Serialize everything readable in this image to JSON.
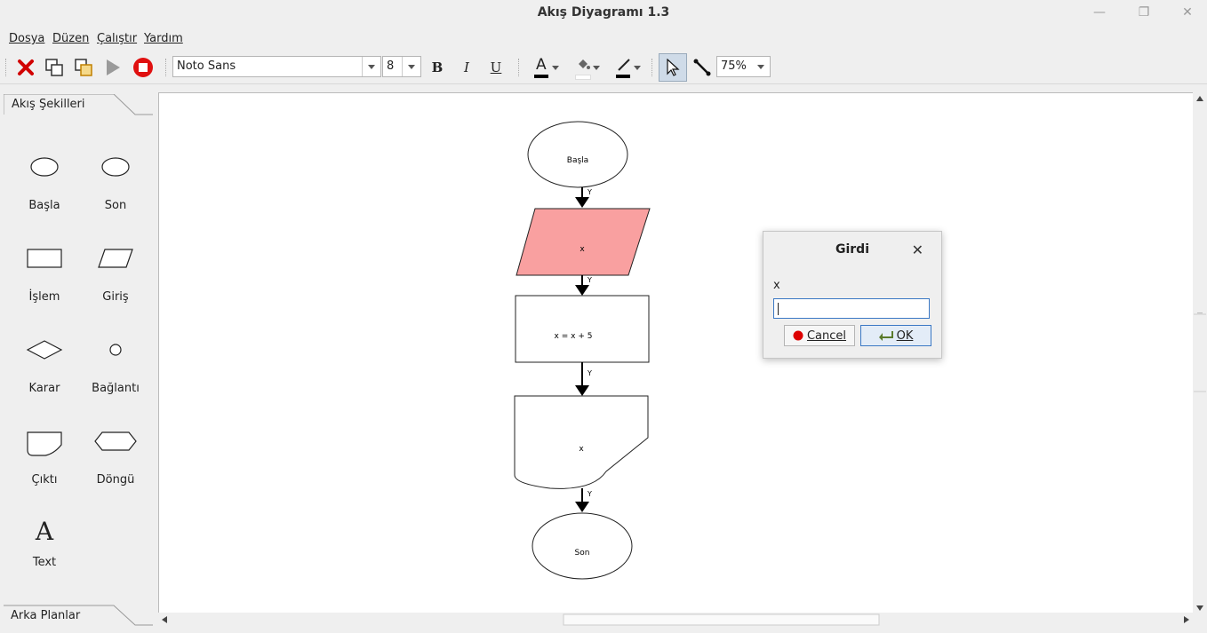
{
  "window": {
    "title": "Akış Diyagramı 1.3",
    "controls": [
      "minimize-icon",
      "maximize-icon",
      "close-icon"
    ]
  },
  "menu": [
    {
      "label": "Dosya"
    },
    {
      "label": "Düzen"
    },
    {
      "label": "Çalıştır"
    },
    {
      "label": "Yardım"
    }
  ],
  "toolbar": {
    "font_name": "Noto Sans",
    "font_size": "8",
    "bold": "B",
    "italic": "I",
    "underline": "U",
    "text_color_glyph": "A",
    "zoom": "75%",
    "icons": [
      "delete-icon",
      "copy-icon",
      "paste-icon",
      "run-icon",
      "stop-icon",
      "pointer-icon",
      "connector-icon"
    ]
  },
  "sidebar": {
    "header": "Akış Şekilleri",
    "footer": "Arka Planlar",
    "shapes": [
      {
        "label": "Başla",
        "icon": "ellipse-icon"
      },
      {
        "label": "Son",
        "icon": "ellipse-icon"
      },
      {
        "label": "İşlem",
        "icon": "rectangle-icon"
      },
      {
        "label": "Giriş",
        "icon": "parallelogram-icon"
      },
      {
        "label": "Karar",
        "icon": "diamond-icon"
      },
      {
        "label": "Bağlantı",
        "icon": "circle-icon"
      },
      {
        "label": "Çıktı",
        "icon": "document-icon"
      },
      {
        "label": "Döngü",
        "icon": "hexagon-icon"
      },
      {
        "label": "Text",
        "icon": "text-icon",
        "glyph": "A"
      }
    ]
  },
  "flowchart": {
    "nodes": [
      {
        "id": "start",
        "type": "terminal",
        "text": "Başla"
      },
      {
        "id": "input",
        "type": "input",
        "text": "x",
        "highlight": "#f9a0a0"
      },
      {
        "id": "process",
        "type": "process",
        "text": "x = x + 5"
      },
      {
        "id": "output",
        "type": "output",
        "text": "x"
      },
      {
        "id": "end",
        "type": "terminal",
        "text": "Son"
      }
    ],
    "edge_label": "Y"
  },
  "dialog": {
    "title": "Girdi",
    "prompt": "x",
    "value": "",
    "cancel_label": "Cancel",
    "ok_label": "OK"
  }
}
